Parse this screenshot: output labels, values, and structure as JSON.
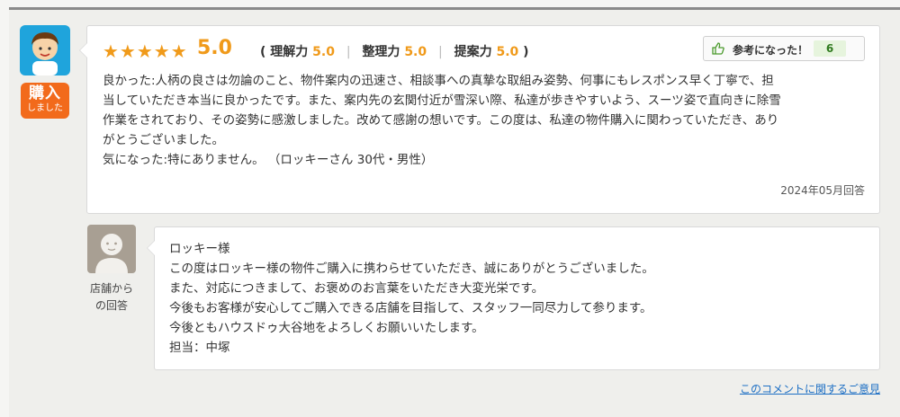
{
  "review": {
    "stars": "★★★★★",
    "score": "5.0",
    "sub_scores": [
      {
        "label": "理解力",
        "value": "5.0"
      },
      {
        "label": "整理力",
        "value": "5.0"
      },
      {
        "label": "提案力",
        "value": "5.0"
      }
    ],
    "helpful_label": "参考になった！",
    "helpful_count": "6",
    "body_lines": [
      "良かった:人柄の良さは勿論のこと、物件案内の迅速さ、相談事への真摯な取組み姿勢、何事にもレスポンス早く丁寧で、担",
      "当していただき本当に良かったです。また、案内先の玄関付近が雪深い際、私達が歩きやすいよう、スーツ姿で直向きに除雪",
      "作業をされており、その姿勢に感激しました。改めて感謝の想いです。この度は、私達の物件購入に関わっていただき、あり",
      "がとうございました。",
      "気になった:特にありません。 （ロッキーさん 30代・男性）"
    ],
    "date": "2024年05月回答"
  },
  "badge": {
    "line1": "購入",
    "line2": "しました"
  },
  "shop": {
    "label_line1": "店舗から",
    "label_line2": "の回答",
    "reply_lines": [
      "ロッキー様",
      "この度はロッキー様の物件ご購入に携わらせていただき、誠にありがとうございました。",
      "また、対応につきまして、お褒めのお言葉をいただき大変光栄です。",
      "今後もお客様が安心してご購入できる店舗を目指して、スタッフ一同尽力して参ります。",
      "今後ともハウスドゥ大谷地をよろしくお願いいたします。",
      "担当：中塚"
    ]
  },
  "footer": {
    "opinion_link": "このコメントに関するご意見"
  },
  "icons": {
    "user": "user-avatar-icon",
    "shop": "shop-avatar-icon",
    "helpful": "thumbs-up-icon"
  },
  "colors": {
    "accent": "#f09a1a",
    "badge": "#f26a1b",
    "avatar_bg": "#1fa4dc",
    "link": "#1d6fc4"
  }
}
